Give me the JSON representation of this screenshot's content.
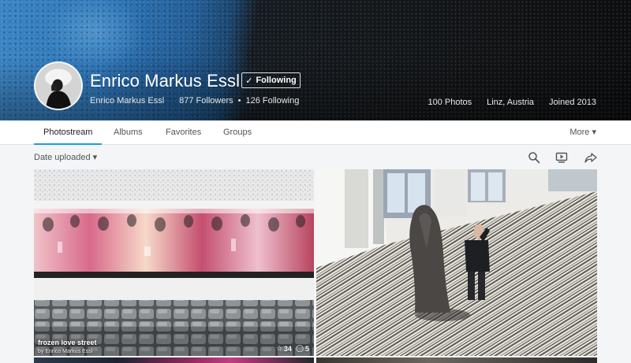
{
  "profile": {
    "display_name": "Enrico Markus Essl",
    "follow_label": "Following",
    "username": "Enrico Markus Essl",
    "followers": "877 Followers",
    "following": "126 Following",
    "separator": "•",
    "photos": "100 Photos",
    "location": "Linz, Austria",
    "joined": "Joined 2013"
  },
  "tabs": [
    {
      "label": "Photostream",
      "active": true
    },
    {
      "label": "Albums",
      "active": false
    },
    {
      "label": "Favorites",
      "active": false
    },
    {
      "label": "Groups",
      "active": false
    }
  ],
  "more_label": "More ▾",
  "toolbar": {
    "sort_label": "Date uploaded ▾",
    "icons": [
      "search-icon",
      "slideshow-icon",
      "share-icon"
    ]
  },
  "photos": [
    {
      "title": "frozen love street",
      "author": "by Enrico Markus Essl",
      "faves": "34",
      "comments": "5"
    }
  ],
  "colors": {
    "accent": "#1c9be6",
    "background": "#f3f5f6"
  }
}
